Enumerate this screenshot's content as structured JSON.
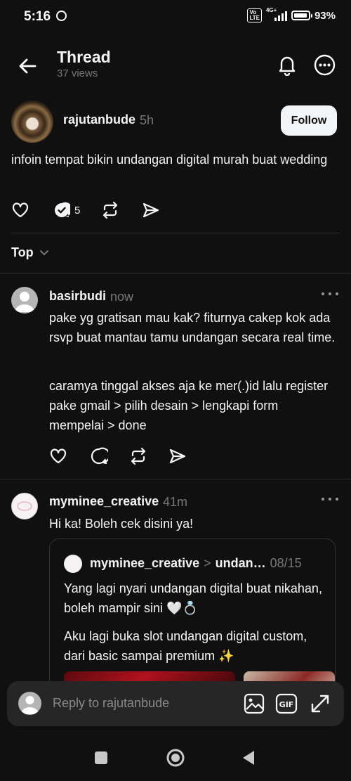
{
  "status_bar": {
    "time": "5:16",
    "network_badge": "Vo\nLTE",
    "network_type": "4G+",
    "battery_level": 0.93,
    "battery_pct": "93%"
  },
  "header": {
    "title": "Thread",
    "views": "37 views",
    "icons": [
      "back-arrow-icon",
      "bell-icon",
      "more-icon"
    ]
  },
  "post": {
    "username": "rajutanbude",
    "time": "5h",
    "follow_label": "Follow",
    "text": "infoin tempat bikin undangan digital murah buat wedding",
    "reply_count": "5"
  },
  "sort": {
    "label": "Top"
  },
  "comments": [
    {
      "username": "basirbudi",
      "time": "now",
      "paragraphs": [
        "pake yg gratisan mau kak? fiturnya cakep kok ada rsvp buat mantau tamu undangan secara real time.",
        "caramya tinggal akses aja ke mer(.)id lalu register pake gmail > pilih desain > lengkapi form mempelai > done"
      ]
    },
    {
      "username": "myminee_creative",
      "time": "41m",
      "text": "Hi ka! Boleh cek disini ya!",
      "quote": {
        "username": "myminee_creative",
        "separator": ">",
        "target": "undan…",
        "date": "08/15",
        "paragraphs": [
          "Yang lagi nyari undangan digital buat nikahan, boleh mampir sini 🤍💍",
          "Aku lagi buka slot undangan digital custom, dari basic sampai premium ✨"
        ]
      }
    }
  ],
  "reply_bar": {
    "placeholder": "Reply to rajutanbude",
    "icons": [
      "image-icon",
      "gif-icon",
      "expand-icon"
    ],
    "gif_label": "GIF"
  },
  "nav_bar": {
    "icons": [
      "recents-icon",
      "home-icon",
      "back-icon"
    ]
  },
  "colors": {
    "background": "#101010",
    "text": "#f3f5f7",
    "muted": "#777777",
    "follow_bg": "#f3f5f7"
  }
}
